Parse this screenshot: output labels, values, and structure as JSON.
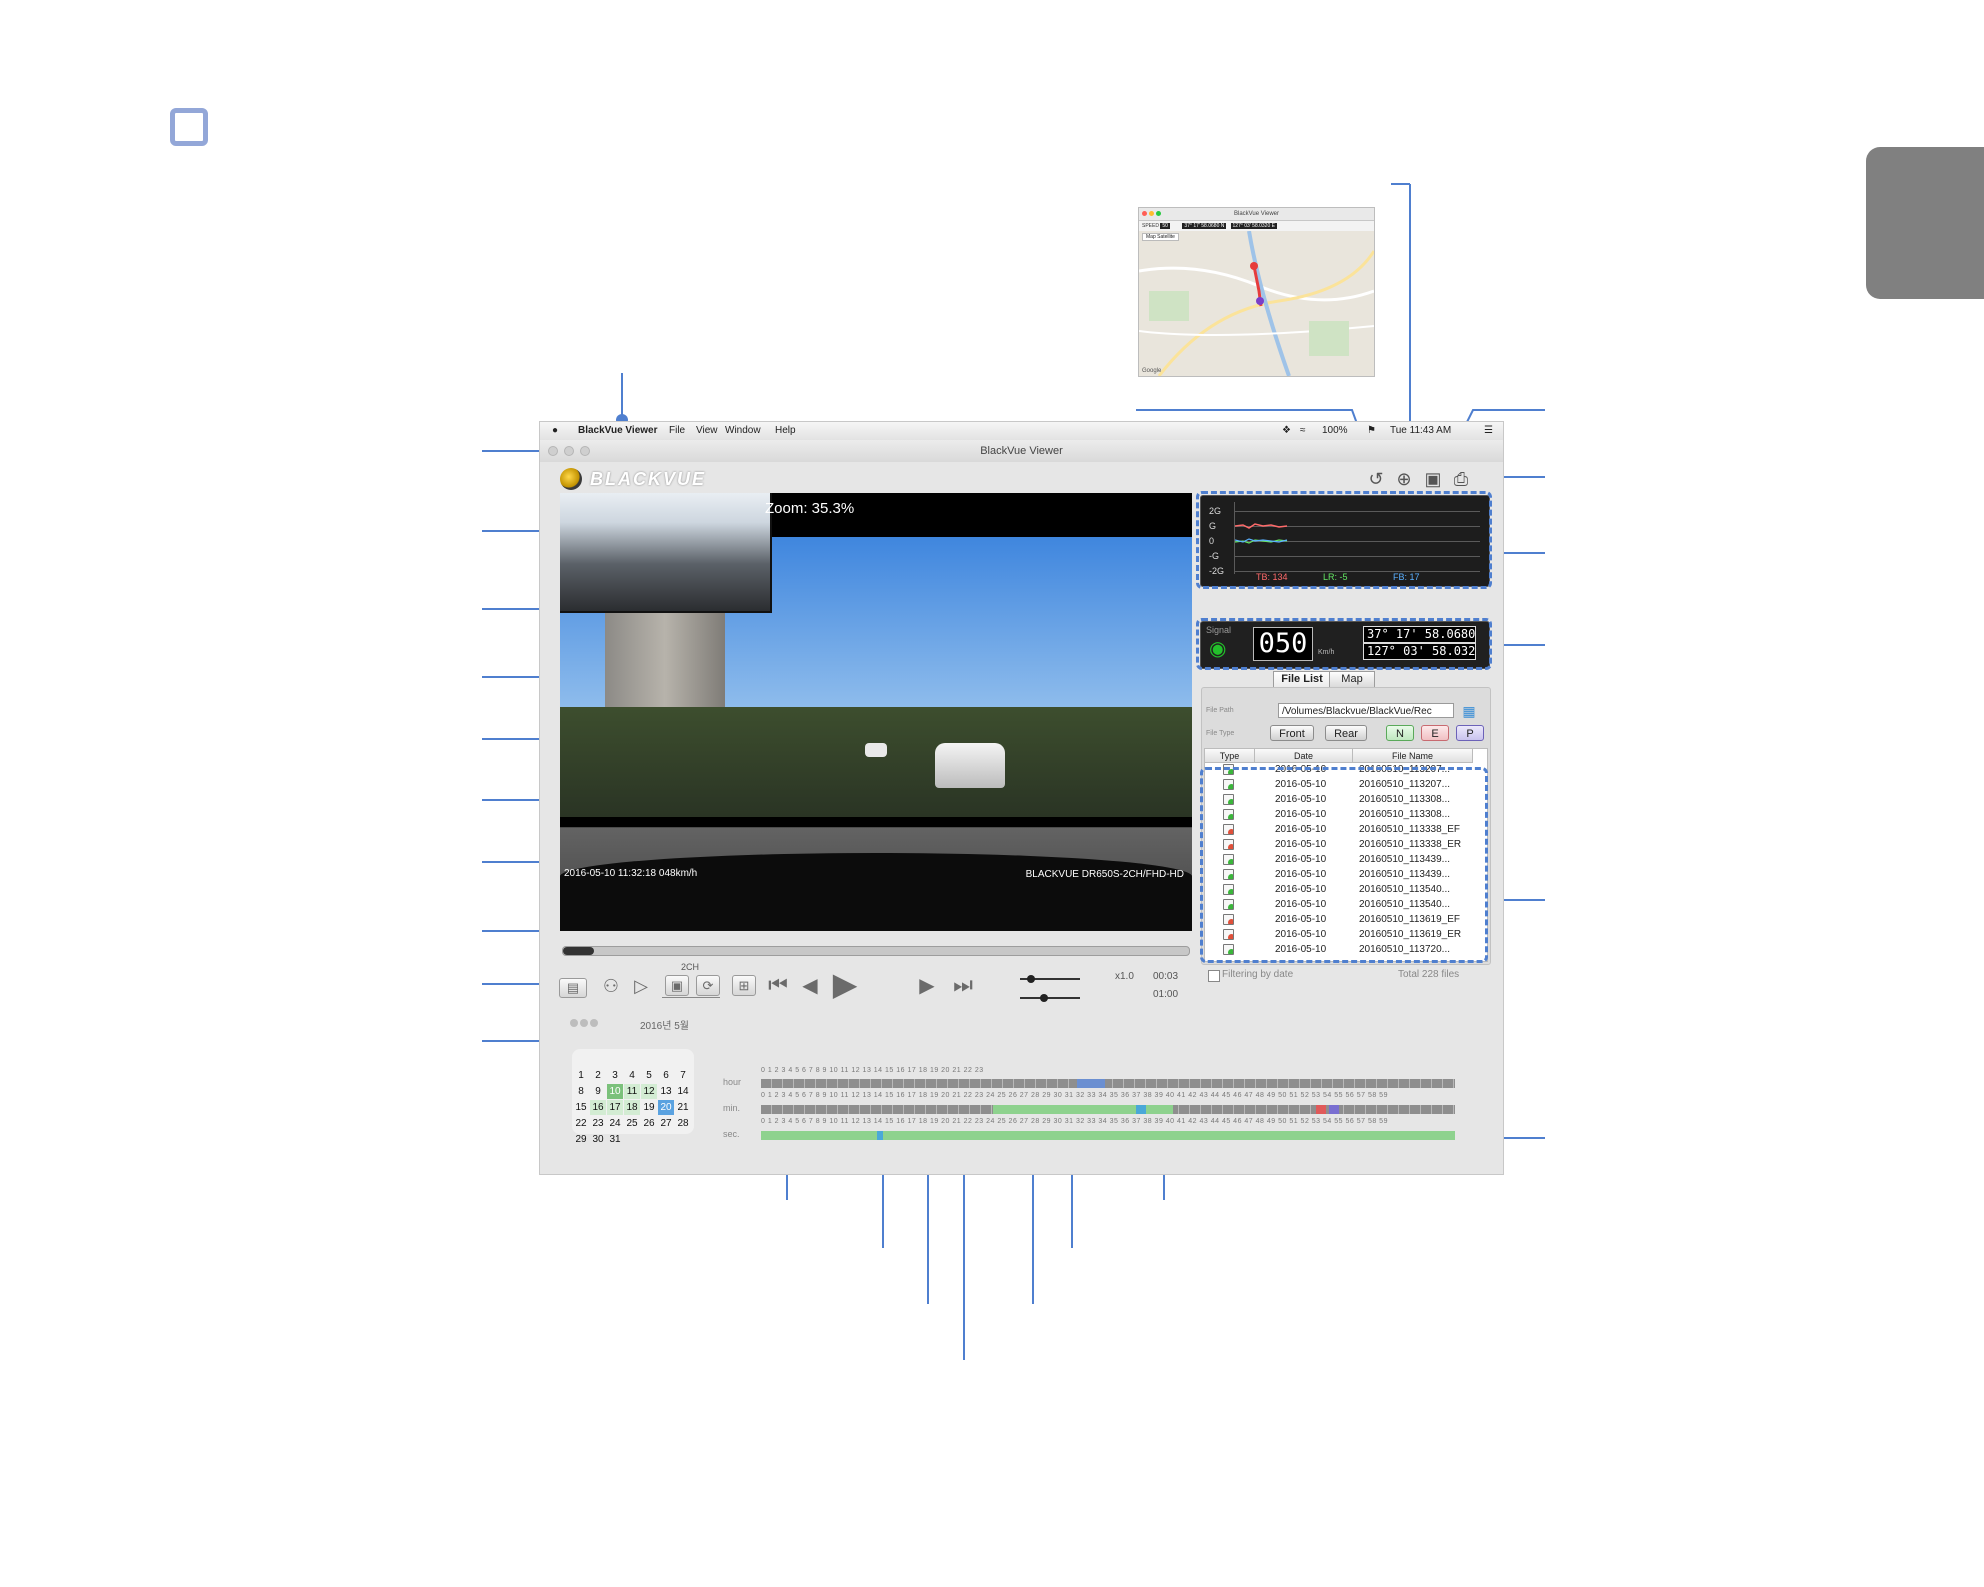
{
  "app": {
    "menu": [
      "BlackVue Viewer",
      "File",
      "View",
      "Window",
      "Help"
    ],
    "status_battery": "100%",
    "status_clock": "Tue 11:43 AM",
    "window_title": "BlackVue Viewer",
    "logo_text": "BLACKVUE"
  },
  "video": {
    "zoom_label": "Zoom: 35.3%",
    "overlay_left": "2016-05-10 11:32:18  048km/h",
    "overlay_right": "BLACKVUE DR650S-2CH/FHD-HD",
    "progress_fraction": 0.05
  },
  "controls": {
    "channel_label": "2CH",
    "speed_label": "x1.0",
    "time_current": "00:03",
    "time_total": "01:00",
    "calendar_header": "2016년 5월"
  },
  "calendar": {
    "rows": [
      [
        "",
        "",
        "",
        "",
        "",
        "",
        ""
      ],
      [
        "1",
        "2",
        "3",
        "4",
        "5",
        "6",
        "7"
      ],
      [
        "8",
        "9",
        "10",
        "11",
        "12",
        "13",
        "14"
      ],
      [
        "15",
        "16",
        "17",
        "18",
        "19",
        "20",
        "21"
      ],
      [
        "22",
        "23",
        "24",
        "25",
        "26",
        "27",
        "28"
      ],
      [
        "29",
        "30",
        "31",
        "",
        "",
        "",
        ""
      ]
    ],
    "days_with_files": [
      "10",
      "11",
      "12",
      "16",
      "17",
      "18",
      "20"
    ],
    "selected_day": "10",
    "highlight_day": "20"
  },
  "timeline": {
    "hour_label": "hour",
    "min_label": "min.",
    "sec_label": "sec.",
    "hour_ticks": "0    1    2    3    4    5    6    7    8    9    10    11    12    13    14    15    16    17    18    19    20    21    22    23",
    "minute_ticks": "0 1 2 3 4 5 6 7 8 9 10 11 12 13 14 15 16 17 18 19 20 21 22 23 24 25 26 27 28 29 30 31 32 33 34 35 36 37 38 39 40 41 42 43 44 45 46 47 48 49 50 51 52 53 54 55 56 57 58 59",
    "second_ticks": "0 1 2 3 4 5 6 7 8 9 10 11 12 13 14 15 16 17 18 19 20 21 22 23 24 25 26 27 28 29 30 31 32 33 34 35 36 37 38 39 40 41 42 43 44 45 46 47 48 49 50 51 52 53 54 55 56 57 58 59"
  },
  "gsensor": {
    "axis_labels": [
      "2G",
      "G",
      "0",
      "-G",
      "-2G"
    ],
    "tb": "TB: 134",
    "lr": "LR: -5",
    "fb": "FB: 17",
    "colors": {
      "tb": "#ff6a6a",
      "lr": "#64e764",
      "fb": "#5ab0ff"
    }
  },
  "gps": {
    "signal_label": "Signal",
    "speed": "050",
    "speed_unit": "Km/h",
    "latitude": "37° 17' 58.0680 N",
    "longitude": "127° 03' 58.0320 E"
  },
  "file_panel": {
    "tabs": [
      "File List",
      "Map"
    ],
    "path_label": "File Path",
    "path_value": "/Volumes/Blackvue/BlackVue/Rec",
    "type_label": "File Type",
    "type_buttons": [
      "Front",
      "Rear",
      "N",
      "E",
      "P"
    ],
    "columns": [
      "Type",
      "Date",
      "File Name"
    ],
    "rows": [
      {
        "type": "normal",
        "date": "2016-05-10",
        "name": "20160510_113207..."
      },
      {
        "type": "normal",
        "date": "2016-05-10",
        "name": "20160510_113207..."
      },
      {
        "type": "normal",
        "date": "2016-05-10",
        "name": "20160510_113308..."
      },
      {
        "type": "normal",
        "date": "2016-05-10",
        "name": "20160510_113308..."
      },
      {
        "type": "event",
        "date": "2016-05-10",
        "name": "20160510_113338_EF"
      },
      {
        "type": "event",
        "date": "2016-05-10",
        "name": "20160510_113338_ER"
      },
      {
        "type": "normal",
        "date": "2016-05-10",
        "name": "20160510_113439..."
      },
      {
        "type": "normal",
        "date": "2016-05-10",
        "name": "20160510_113439..."
      },
      {
        "type": "normal",
        "date": "2016-05-10",
        "name": "20160510_113540..."
      },
      {
        "type": "normal",
        "date": "2016-05-10",
        "name": "20160510_113540..."
      },
      {
        "type": "event",
        "date": "2016-05-10",
        "name": "20160510_113619_EF"
      },
      {
        "type": "event",
        "date": "2016-05-10",
        "name": "20160510_113619_ER"
      },
      {
        "type": "normal",
        "date": "2016-05-10",
        "name": "20160510_113720..."
      }
    ],
    "filter_label": "Filtering by date",
    "total_label": "Total 228 files"
  },
  "icons": [
    "loop-icon",
    "gps-target-icon",
    "camera-icon",
    "print-icon",
    "wifi-signal-icon",
    "folder-icon",
    "play-icon",
    "previous-file-icon",
    "next-file-icon",
    "step-back-icon",
    "step-forward-icon",
    "split-view-icon",
    "rotate-icon",
    "swap-channel-icon",
    "open-file-icon",
    "zoom-in-icon",
    "zoom-out-icon"
  ],
  "map_inset": {
    "title": "BlackVue Viewer",
    "speed_label": "SPEED",
    "speed_value": "50",
    "lat": "37° 17' 58.0680 N",
    "lon": "127° 03' 58.0320 E",
    "map_tabs": "Map  Satellite",
    "attribution": "Google"
  }
}
